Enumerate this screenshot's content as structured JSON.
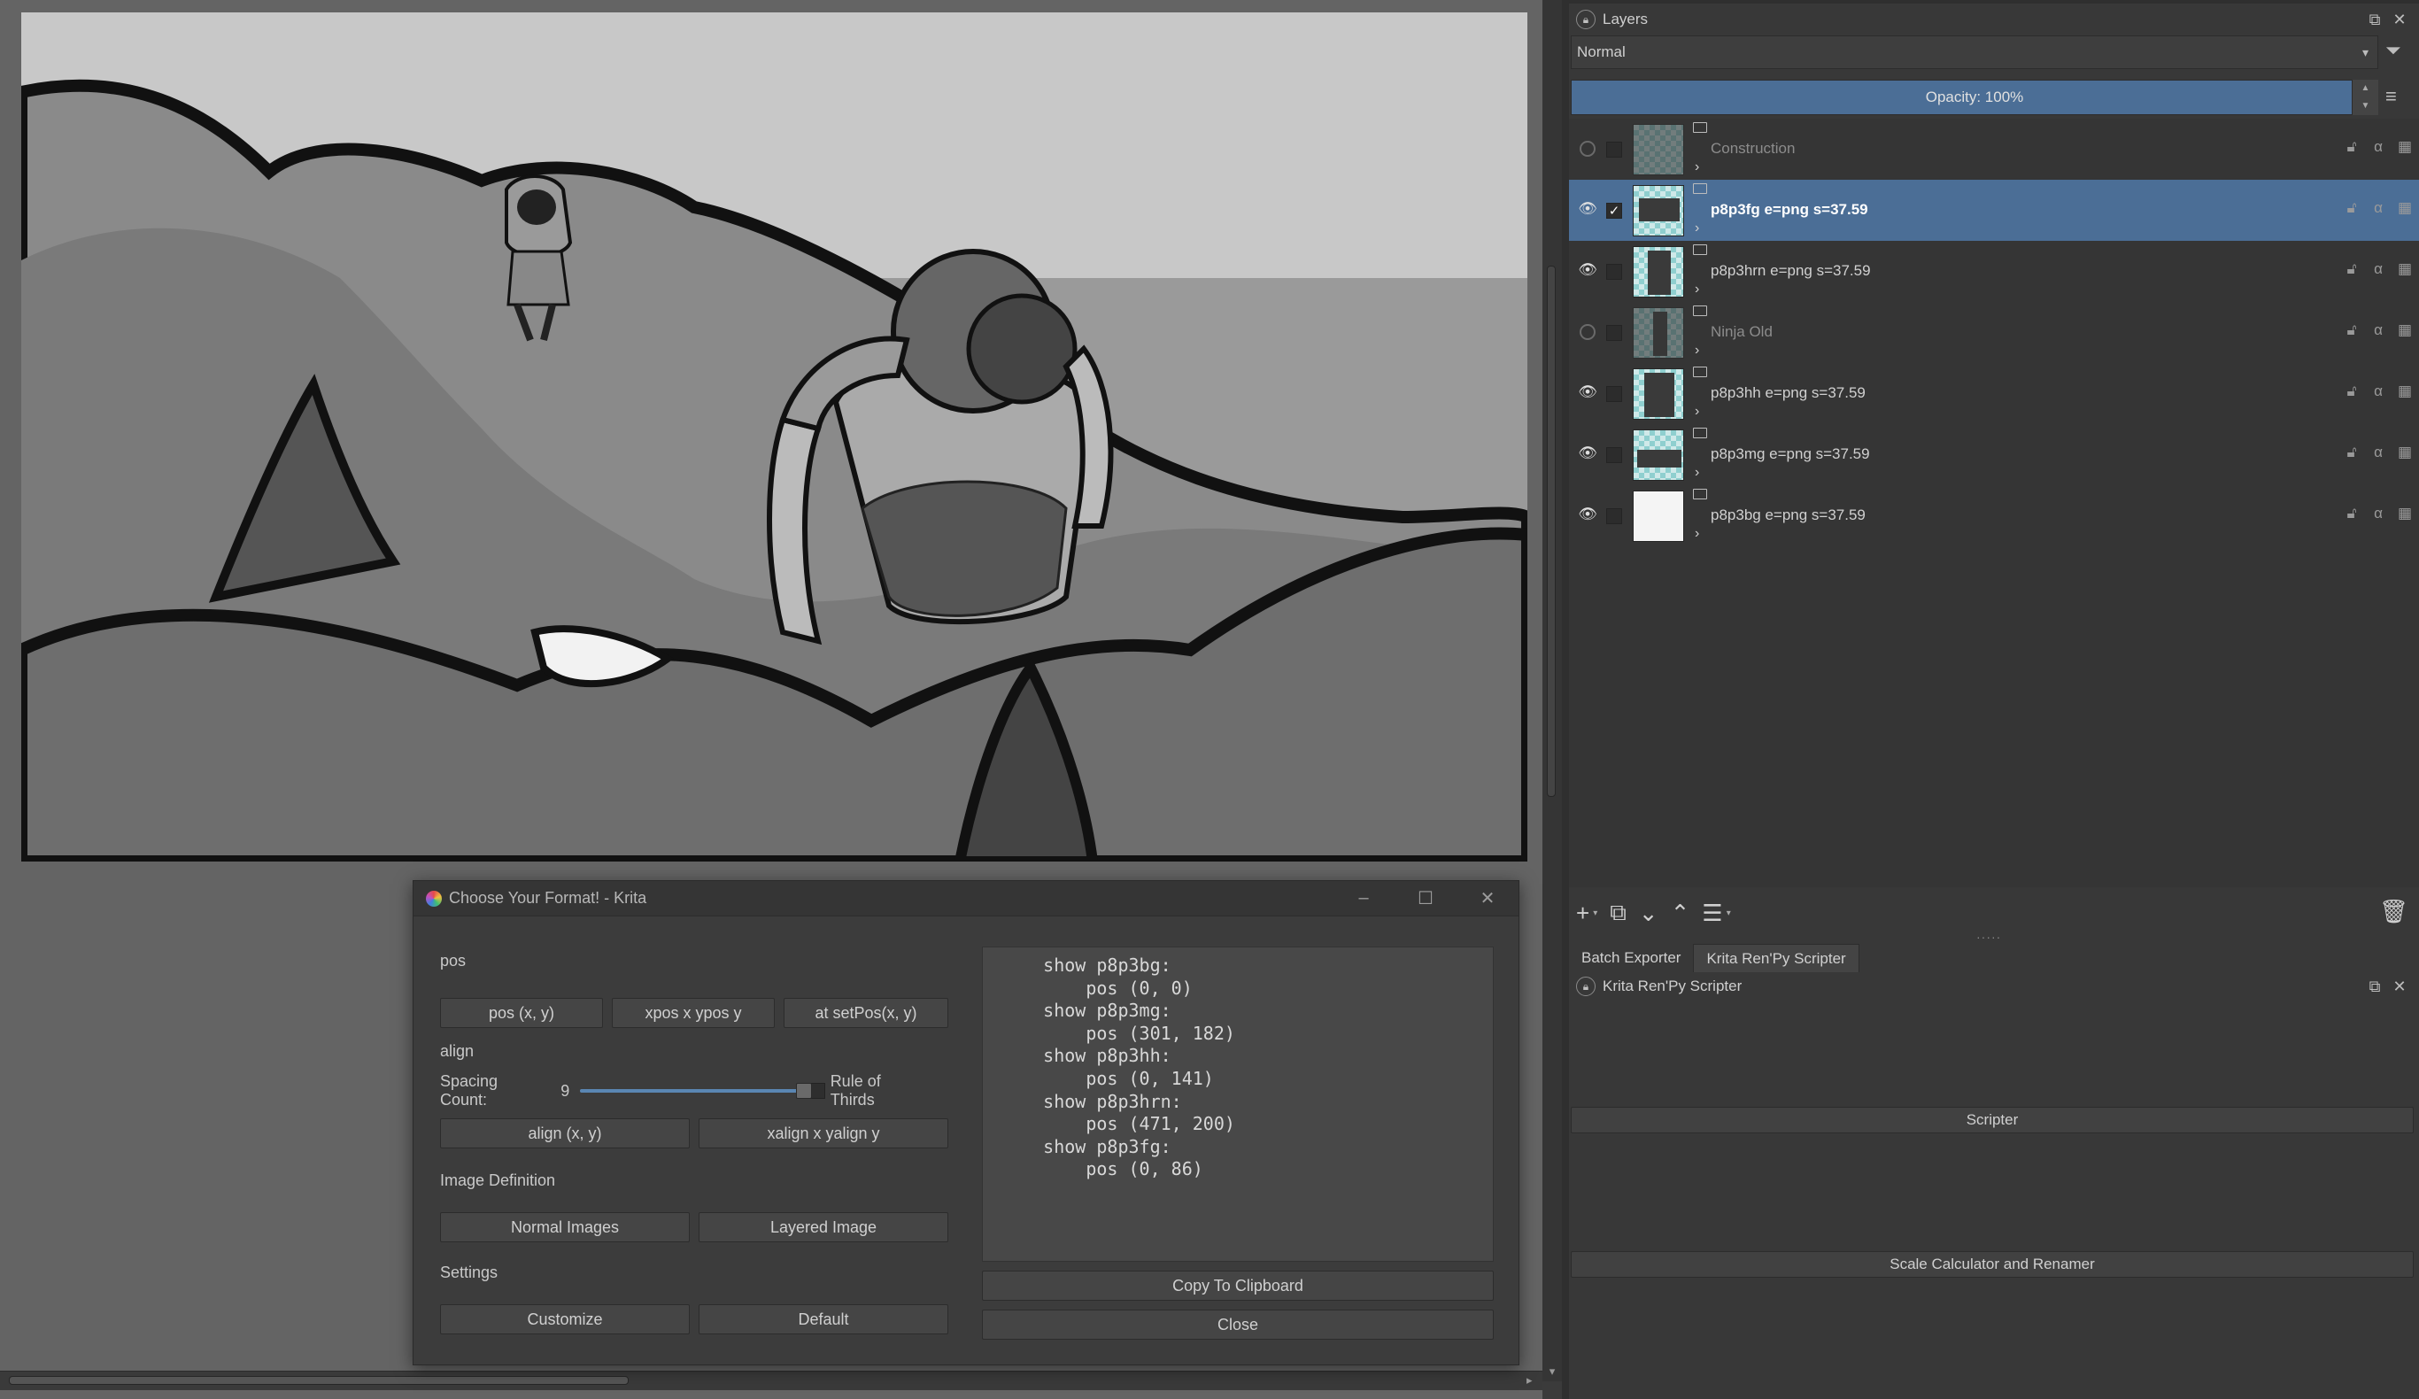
{
  "dialog": {
    "title": "Choose Your Format! - Krita",
    "window_controls": [
      "–",
      "☐",
      "✕"
    ],
    "pos_section": "pos",
    "pos_buttons": [
      "pos (x, y)",
      "xpos x ypos y",
      "at setPos(x, y)"
    ],
    "align_section": "align",
    "spacing_label": "Spacing Count:",
    "spacing_value": "9",
    "spacing_fraction": 1.0,
    "rule_of_thirds": "Rule of Thirds",
    "align_buttons": [
      "align (x, y)",
      "xalign x yalign y"
    ],
    "image_def_section": "Image Definition",
    "image_def_buttons": [
      "Normal Images",
      "Layered Image"
    ],
    "settings_section": "Settings",
    "settings_buttons": [
      "Customize",
      "Default"
    ],
    "code_output": "    show p8p3bg:\n        pos (0, 0)\n    show p8p3mg:\n        pos (301, 182)\n    show p8p3hh:\n        pos (0, 141)\n    show p8p3hrn:\n        pos (471, 200)\n    show p8p3fg:\n        pos (0, 86)",
    "copy_button": "Copy To Clipboard",
    "close_button": "Close"
  },
  "layers_docker": {
    "title": "Layers",
    "blend_mode": "Normal",
    "opacity_label": "Opacity:  100%",
    "layers": [
      {
        "name": "Construction",
        "visible": false,
        "selected": false,
        "dim": true
      },
      {
        "name": "p8p3fg e=png s=37.59",
        "visible": true,
        "selected": true,
        "dim": false
      },
      {
        "name": "p8p3hrn e=png s=37.59",
        "visible": true,
        "selected": false,
        "dim": false
      },
      {
        "name": "Ninja Old",
        "visible": false,
        "selected": false,
        "dim": true
      },
      {
        "name": "p8p3hh e=png s=37.59",
        "visible": true,
        "selected": false,
        "dim": false
      },
      {
        "name": "p8p3mg e=png s=37.59",
        "visible": true,
        "selected": false,
        "dim": false
      },
      {
        "name": "p8p3bg e=png s=37.59",
        "visible": true,
        "selected": false,
        "dim": false
      }
    ]
  },
  "tabs": [
    "Batch Exporter",
    "Krita Ren'Py Scripter"
  ],
  "scripter_docker": {
    "title": "Krita Ren'Py Scripter",
    "scripter_button": "Scripter",
    "scale_button": "Scale Calculator and Renamer"
  },
  "colors": {
    "selection_blue": "#4b6e96",
    "panel_bg": "#383838",
    "dialog_bg": "#3c3c3c"
  }
}
